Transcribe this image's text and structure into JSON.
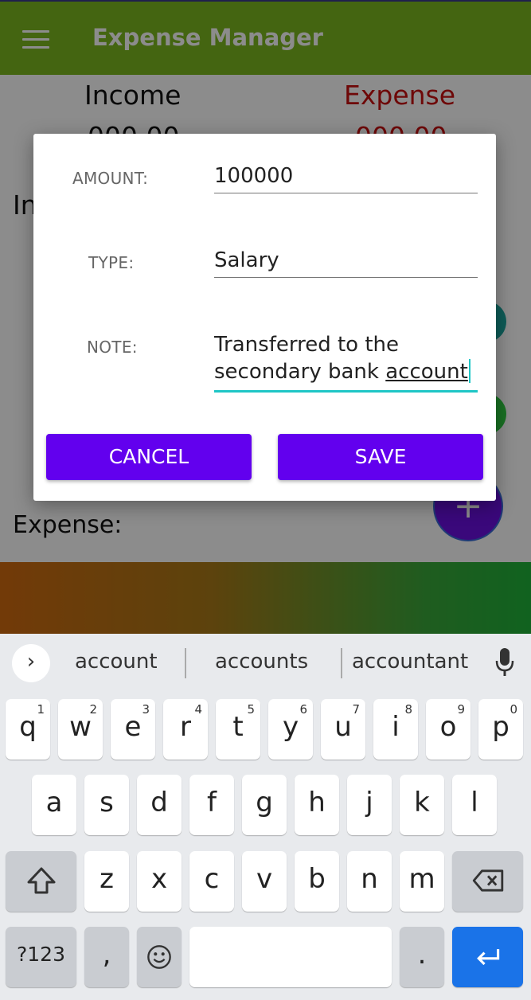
{
  "app_bar": {
    "title": "Expense Manager",
    "menu_icon": "hamburger-menu-icon"
  },
  "summary": {
    "income_label": "Income",
    "expense_label": "Expense",
    "income_value": "000.00",
    "expense_value": "000.00",
    "expense_color": "#c81010"
  },
  "main": {
    "income_section_label": "Income:",
    "expense_section_label": "Expense:",
    "fab_label": "+"
  },
  "dialog": {
    "amount_label": "AMOUNT:",
    "amount_value": "100000",
    "type_label": "TYPE:",
    "type_value": "Salary",
    "note_label": "NOTE:",
    "note_line1": "Transferred to the",
    "note_line2_prefix": "secondary bank ",
    "note_line2_word": "account",
    "cancel_label": "CANCEL",
    "save_label": "SAVE",
    "accent_color": "#6200ee"
  },
  "keyboard": {
    "suggestions": [
      "account",
      "accounts",
      "accountant"
    ],
    "row1": [
      {
        "k": "q",
        "n": "1"
      },
      {
        "k": "w",
        "n": "2"
      },
      {
        "k": "e",
        "n": "3"
      },
      {
        "k": "r",
        "n": "4"
      },
      {
        "k": "t",
        "n": "5"
      },
      {
        "k": "y",
        "n": "6"
      },
      {
        "k": "u",
        "n": "7"
      },
      {
        "k": "i",
        "n": "8"
      },
      {
        "k": "o",
        "n": "9"
      },
      {
        "k": "p",
        "n": "0"
      }
    ],
    "row2": [
      "a",
      "s",
      "d",
      "f",
      "g",
      "h",
      "j",
      "k",
      "l"
    ],
    "row3": [
      "z",
      "x",
      "c",
      "v",
      "b",
      "n",
      "m"
    ],
    "symbols_label": "?123",
    "comma": ",",
    "period": "."
  }
}
